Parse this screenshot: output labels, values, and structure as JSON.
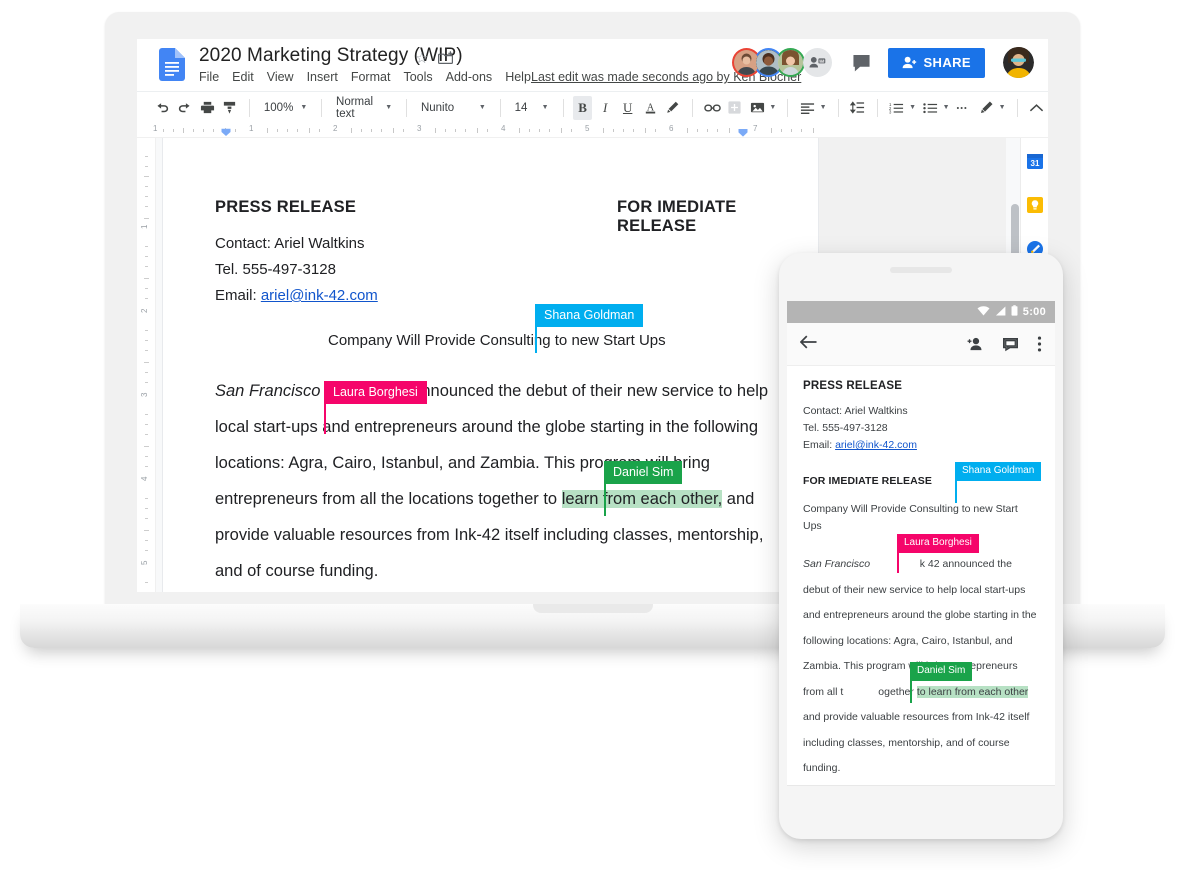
{
  "app": {
    "name": "Google Docs",
    "doc_title": "2020 Marketing Strategy (WIP)",
    "icons": {
      "docs": "docs-file-icon",
      "star": "star-icon",
      "drive_move": "move-to-drive-folder-icon",
      "comment": "comment-icon",
      "share_person": "person-add-icon",
      "add_collaborator": "add-collaborator-icon"
    },
    "last_edit": "Last edit was made seconds ago by Ken Blocher",
    "share_label": "SHARE"
  },
  "menubar": [
    "File",
    "Edit",
    "View",
    "Insert",
    "Format",
    "Tools",
    "Add-ons",
    "Help"
  ],
  "toolbar": {
    "undo": "undo-icon",
    "redo": "redo-icon",
    "print": "print-icon",
    "paint_format": "paint-format-icon",
    "zoom": "100%",
    "style": "Normal text",
    "font": "Nunito",
    "font_size": "14",
    "bold": "B",
    "italic": "I",
    "underline": "U",
    "text_color": "A",
    "highlight": "highlight-pen-icon",
    "link": "link-icon",
    "comment_add": "add-comment-icon",
    "image": "insert-image-icon",
    "align": "align-left-icon",
    "line_spacing": "line-spacing-icon",
    "numbered_list": "numbered-list-icon",
    "bulleted_list": "bulleted-list-icon",
    "more": "more-options-icon",
    "editing_mode": "editing-pencil-icon",
    "collapse": "collapse-toolbar-icon"
  },
  "ruler": {
    "horizontal_numbers": [
      "1",
      "1",
      "2",
      "3",
      "4",
      "5",
      "6",
      "7"
    ],
    "vertical_numbers": [
      "1",
      "2",
      "3",
      "4",
      "5"
    ]
  },
  "side_panel": [
    {
      "name": "google-calendar-icon",
      "glyph": "31",
      "color": "#1a73e8"
    },
    {
      "name": "google-keep-icon",
      "glyph": "●",
      "color": "#fbbc04"
    },
    {
      "name": "google-tasks-icon",
      "glyph": "✎",
      "color": "#1a73e8"
    }
  ],
  "document": {
    "heading": "PRESS RELEASE",
    "release_note": "FOR IMEDIATE RELEASE",
    "contact": "Contact: Ariel Waltkins",
    "tel": "Tel. 555-497-3128",
    "email_label": "Email: ",
    "email": "ariel@ink-42.com",
    "subhead_before": "Company Will Provide Consulting",
    "subhead_after": "to new Start Ups",
    "body_city": "San Francisco",
    "body_p1": "42 announced the debut of their new service to help local start-ups and entrepreneurs around the globe starting in the following locations: Agra, Cairo, Istanbul, and Zambia. This program will bring entrepreneurs from all the locations together to ",
    "body_highlight": "learn from each other,",
    "body_p2": " and provide valuable resources from Ink-42 itself including classes, mentorship, and of course funding."
  },
  "collaborators": [
    {
      "name": "Shana Goldman",
      "color": "#00aeef"
    },
    {
      "name": "Laura Borghesi",
      "color": "#f5056a"
    },
    {
      "name": "Daniel Sim",
      "color": "#1aa34a"
    }
  ],
  "phone": {
    "status_time": "5:00",
    "icons": {
      "wifi": "wifi-icon",
      "signal": "cell-signal-icon",
      "battery": "battery-icon",
      "back": "back-arrow-icon",
      "add_person": "add-person-icon",
      "comment": "comment-icon",
      "overflow": "overflow-menu-icon"
    },
    "heading": "PRESS RELEASE",
    "contact": "Contact: Ariel Waltkins",
    "tel": "Tel. 555-497-3128",
    "email_label": "Email: ",
    "email": "ariel@ink-42.com",
    "release_note": "FOR IMEDIATE RELEASE",
    "subhead_before": "Company Will Provide Consulting",
    "subhead_after": "to new Start Ups",
    "body_city": "San Francisco",
    "body_p1": "k 42 announced the debut of their new service to help local start-ups and entrepreneurs around the globe starting in the following locations: Agra, Cairo, Istanbul, and Zambia. This program will bring entrepreneurs from all t",
    "body_mid": "ogether ",
    "body_highlight": "to learn from each other",
    "body_p2": " and provide valuable resources from Ink-42 itself including classes, mentorship, and of course funding."
  }
}
